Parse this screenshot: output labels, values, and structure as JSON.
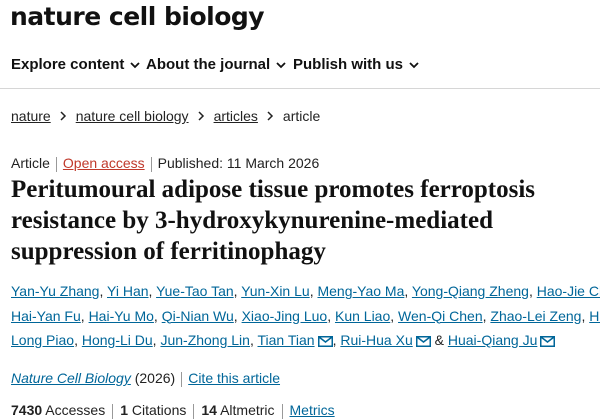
{
  "site": {
    "title": "nature cell biology"
  },
  "nav": {
    "items": [
      "Explore content",
      "About the journal",
      "Publish with us"
    ]
  },
  "breadcrumb": {
    "items": [
      "nature",
      "nature cell biology",
      "articles"
    ],
    "current": "article"
  },
  "article": {
    "type": "Article",
    "access": "Open access",
    "published": "Published: 11 March 2026",
    "title_lines": [
      "Peritumoural adipose tissue promotes ferroptosis",
      "resistance by 3-hydroxykynurenine-mediated",
      "suppression of ferritinophagy"
    ]
  },
  "authors": {
    "list": [
      "Yan-Yu Zhang",
      "Yi Han",
      "Yue-Tao Tan",
      "Yun-Xin Lu",
      "Meng-Yao Ma",
      "Yong-Qiang Zheng",
      "Hao-Jie Chen",
      "Hai-Yan Fu",
      "Hai-Yu Mo",
      "Qi-Nian Wu",
      "Xiao-Jing Luo",
      "Kun Liao",
      "Wen-Qi Chen",
      "Zhao-Lei Zeng",
      "Hai-Long Piao",
      "Hong-Li Du",
      "Jun-Zhong Lin",
      "Tian Tian",
      "Rui-Hua Xu",
      "Huai-Qiang Ju"
    ],
    "hai_long_part1": "Hai-",
    "hai_long_part2": "Long Piao",
    "separator": ",",
    "and": "&"
  },
  "citation": {
    "journal": "Nature Cell Biology",
    "year": "(2026)",
    "cite_link": "Cite this article"
  },
  "metrics": {
    "accesses_count": "7430",
    "accesses_label": "Accesses",
    "citations_count": "1",
    "citations_label": "Citations",
    "altmetric_count": "14",
    "altmetric_label": "Altmetric",
    "metrics_link": "Metrics"
  },
  "colors": {
    "link": "#006699",
    "open_access": "#c0392b",
    "text": "#222222"
  }
}
